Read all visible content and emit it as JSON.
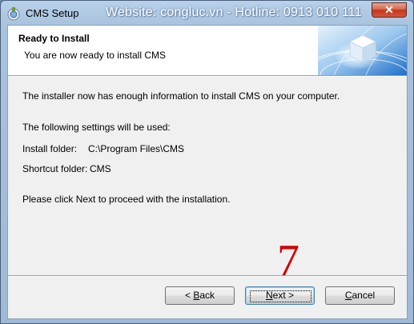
{
  "window": {
    "title": "CMS Setup",
    "watermark": "Website: congluc.vn - Hotline: 0913 010 111",
    "close_glyph": "✕"
  },
  "header": {
    "title": "Ready to Install",
    "subtitle": "You are now ready to install CMS"
  },
  "body": {
    "intro": "The installer now has enough information to install CMS on your computer.",
    "settings_heading": "The following settings will be used:",
    "install_folder_label": "Install folder:",
    "install_folder_value": "C:\\Program Files\\CMS",
    "shortcut_folder_label": "Shortcut folder:",
    "shortcut_folder_value": "CMS",
    "instruction": "Please click Next to proceed with the installation."
  },
  "annotation": {
    "text": "7",
    "color": "#d00000"
  },
  "buttons": {
    "back": {
      "mnemonic": "< ",
      "accel": "B",
      "rest": "ack"
    },
    "next": {
      "accel": "N",
      "rest": "ext >"
    },
    "cancel": {
      "accel": "C",
      "rest": "ancel"
    }
  },
  "colors": {
    "close_button": "#c4361a",
    "banner_blue": "#2a7fd4",
    "annotation": "#d00000"
  }
}
